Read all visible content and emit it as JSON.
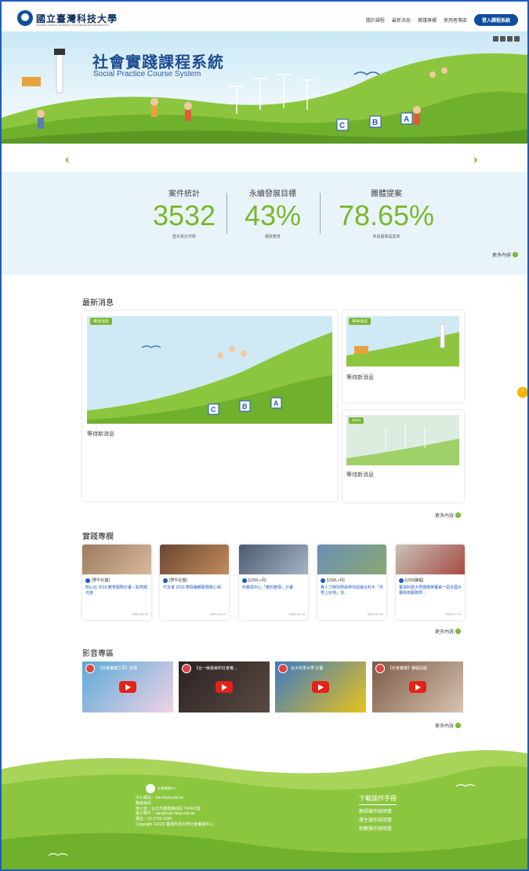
{
  "header": {
    "logo_text": "國立臺灣科技大學",
    "logo_sub": "NATIONAL TAIWAN UNIVERSITY OF SCIENCE AND TECHNOLOGY",
    "nav": [
      "關於課程",
      "最新消息",
      "實踐專欄",
      "使用者專區"
    ],
    "login_label": "登入課程系統"
  },
  "hero": {
    "title": "社會實踐課程系統",
    "subtitle": "Social Practice Course System",
    "blocks": [
      "C",
      "B",
      "A"
    ]
  },
  "carousel": {
    "prev": "‹",
    "next": "›"
  },
  "stats": [
    {
      "label": "案件統計",
      "value": "3532",
      "caption": "歷年累計件數"
    },
    {
      "label": "永續發展目標",
      "value": "43%",
      "caption": "優質教育"
    },
    {
      "label": "團體提案",
      "value": "78.65%",
      "caption": "參與團隊提案率"
    }
  ],
  "more_label": "更多內容",
  "news": {
    "title": "最新消息",
    "items": [
      {
        "tag": "等待消息",
        "text": "等待新消息"
      },
      {
        "tag": "等待消息",
        "text": "等待新消息"
      },
      {
        "tag": "soon",
        "text": "等待新消息"
      }
    ]
  },
  "practice": {
    "title": "實踐專欄",
    "items": [
      {
        "cat": "[學牛社團]",
        "title": "知心社 2019 教育服務計畫－點亮燭光營",
        "date": "2022-01-12"
      },
      {
        "cat": "[學牛社團]",
        "title": "竹友會 2020 寒假偏鄉服務隊心得",
        "date": "2022-01-12"
      },
      {
        "cat": "[USR,+月]",
        "title": "科教與中心「教的聖保」計畫",
        "date": "2022-01-12"
      },
      {
        "cat": "[USR,+月]",
        "title": "專人力特別學員帶你認識台科大「烏學上好地」活...",
        "date": "2022-01-11"
      },
      {
        "cat": "[USR課程]",
        "title": "臺灣科技大學團隊榮獲第一屆全國大專院校服務學...",
        "date": "2022-07-21"
      }
    ]
  },
  "videos": {
    "title": "影音專區",
    "items": [
      {
        "title": "【社會實踐之夢】宣傳",
        "bg": "#5aa9d6"
      },
      {
        "title": "【台一線最美的社會實...",
        "bg": "#3a3230"
      },
      {
        "title": "台大科學大學 計畫",
        "bg": "#e8c21a"
      },
      {
        "title": "【社會實踐】課程回顧",
        "bg": "#b58a6a"
      }
    ]
  },
  "footer": {
    "center": "社會實踐中心",
    "lines": [
      "中心網站：clie.ntust.edu.tw",
      "聯絡資訊",
      "辦公室｜台北市基隆路四段 TR-602室",
      "電子郵件｜sipr@mail.ntust.edu.tw",
      "電話｜02-2730-1099",
      "Copyright ©2022 臺灣科技大學社會實踐中心"
    ],
    "dl_title": "下載操作手冊",
    "dl_items": [
      "教師操作說明書",
      "學生操作說明書",
      "助教操作說明書"
    ]
  },
  "colors": {
    "brand_blue": "#0e4f9c",
    "accent_green": "#79b62e",
    "scroll_top": "#f5b400"
  }
}
